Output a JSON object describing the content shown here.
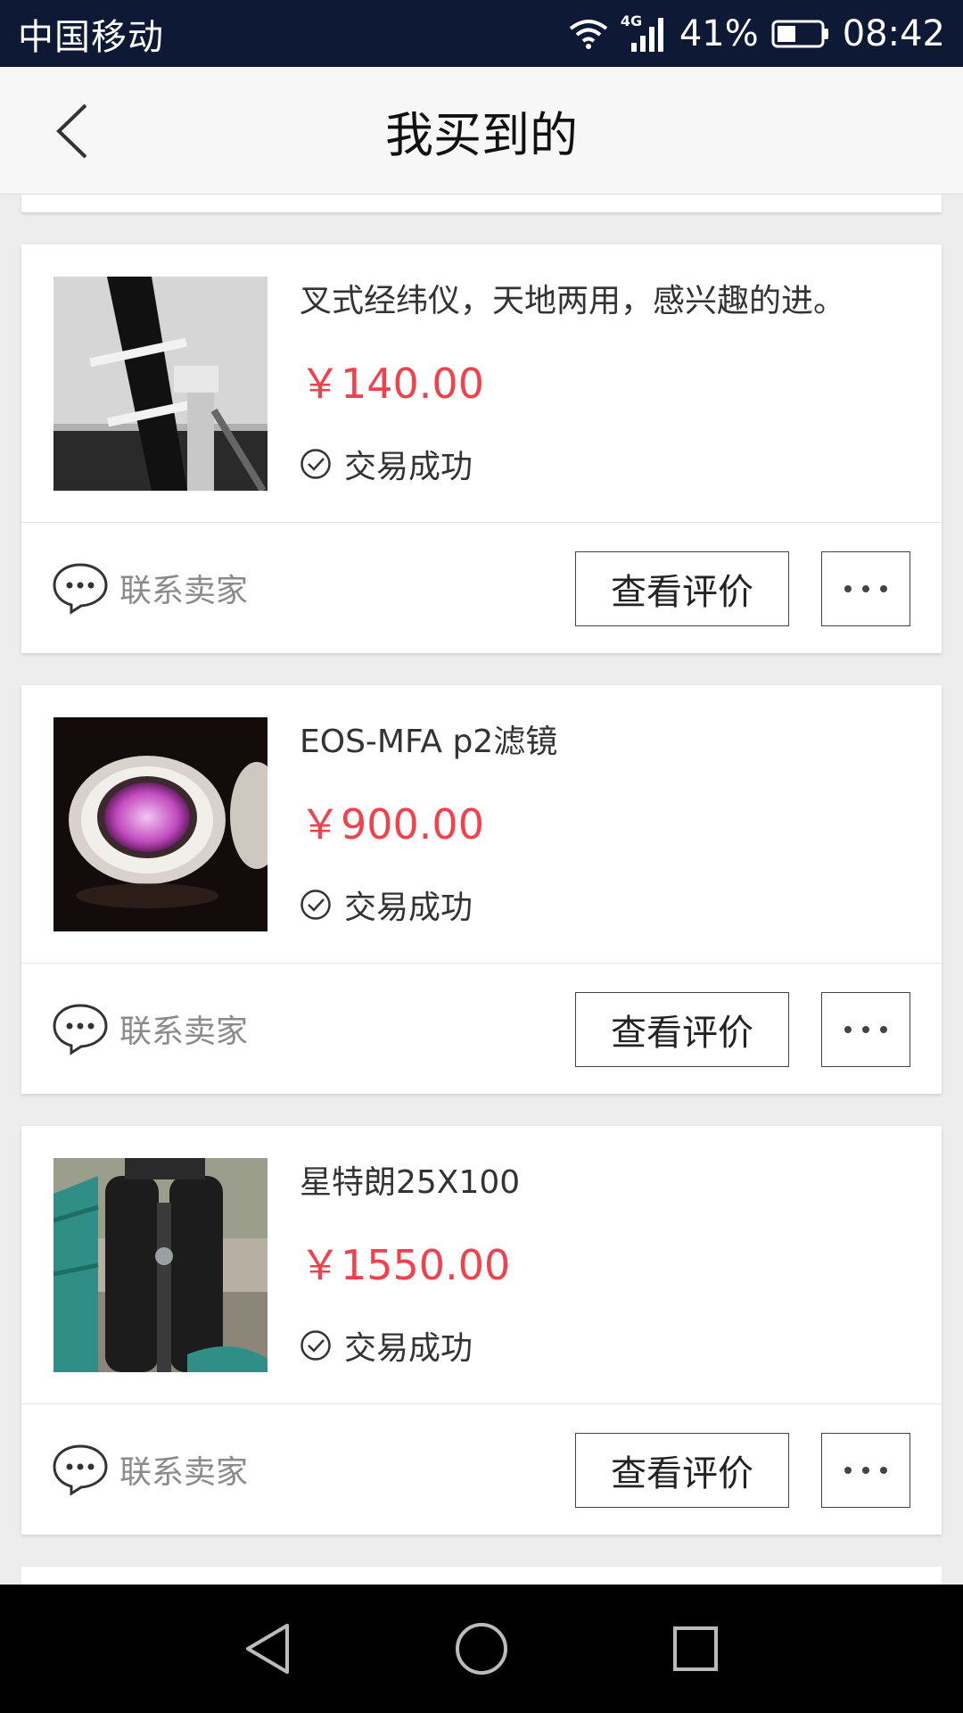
{
  "status_bar": {
    "carrier": "中国移动",
    "network": "4G",
    "battery": "41%",
    "time": "08:42"
  },
  "header": {
    "title": "我买到的"
  },
  "orders": [
    {
      "title": "叉式经纬仪，天地两用，感兴趣的进。",
      "price": "￥140.00",
      "status": "交易成功",
      "contact_label": "联系卖家",
      "review_label": "查看评价"
    },
    {
      "title": "EOS-MFA p2滤镜",
      "price": "￥900.00",
      "status": "交易成功",
      "contact_label": "联系卖家",
      "review_label": "查看评价"
    },
    {
      "title": "星特朗25X100",
      "price": "￥1550.00",
      "status": "交易成功",
      "contact_label": "联系卖家",
      "review_label": "查看评价"
    }
  ],
  "colors": {
    "status_bar_bg": "#0e1935",
    "price": "#f2414b",
    "page_bg": "#ededed"
  }
}
